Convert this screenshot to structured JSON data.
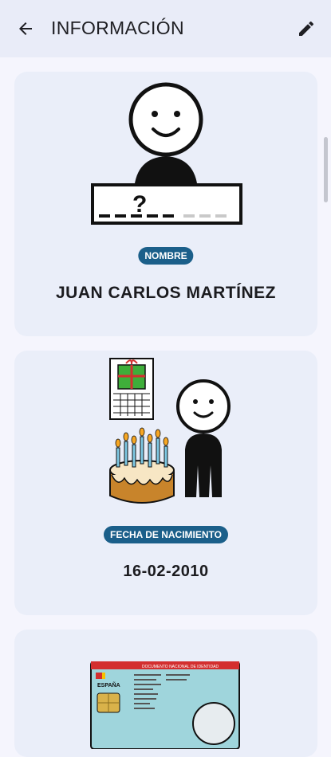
{
  "header": {
    "title": "INFORMACIÓN",
    "back_icon": "arrow-left-icon",
    "edit_icon": "pencil-icon"
  },
  "cards": [
    {
      "badge": "NOMBRE",
      "value": "JUAN CARLOS MARTÍNEZ",
      "pictogram": "person-name-pictogram"
    },
    {
      "badge": "FECHA DE NACIMIENTO",
      "value": "16-02-2010",
      "pictogram": "birthday-pictogram"
    },
    {
      "pictogram": "id-card-pictogram",
      "id_card": {
        "title": "DOCUMENTO NACIONAL DE IDENTIDAD",
        "country": "ESPAÑA"
      }
    }
  ],
  "colors": {
    "badge": "#1b5f8a",
    "card": "#eaeef9",
    "topbar": "#e9ecf8"
  }
}
